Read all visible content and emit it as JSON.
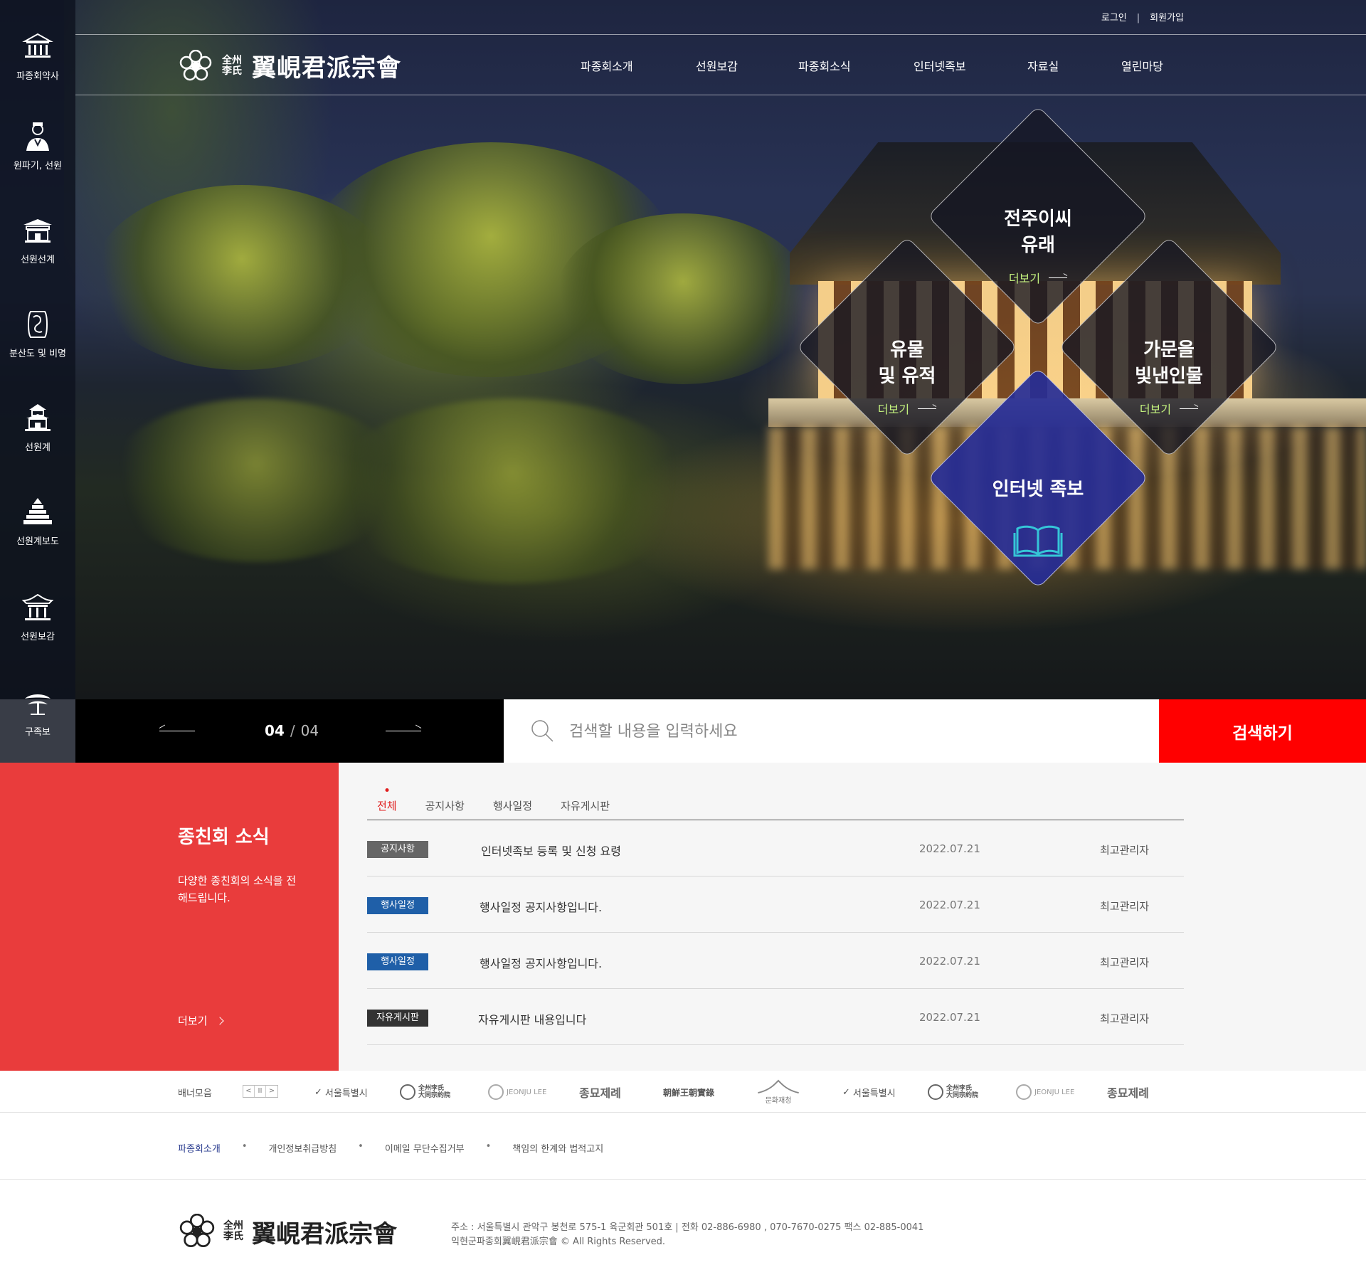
{
  "colors": {
    "accent_red": "#e93c3c",
    "search_red": "#ff0000",
    "diamond_blue": "#262d96",
    "more_green": "#c3f17e"
  },
  "top_links": {
    "login": "로그인",
    "separator": "|",
    "signup": "회원가입"
  },
  "logo": {
    "small_line1": "全州",
    "small_line2": "李氏",
    "big": "翼峴君派宗會"
  },
  "gnb": [
    "파종회소개",
    "선원보감",
    "파종회소식",
    "인터넷족보",
    "자료실",
    "열린마당"
  ],
  "sidebar": [
    {
      "label": "파종회약사",
      "icon": "hall-icon"
    },
    {
      "label": "원파기, 선원",
      "icon": "person-icon"
    },
    {
      "label": "선원선계",
      "icon": "gate-icon"
    },
    {
      "label": "분산도 및 비명",
      "icon": "stone-icon"
    },
    {
      "label": "선원계",
      "icon": "pagoda-icon"
    },
    {
      "label": "선원계보도",
      "icon": "chart-tower-icon"
    },
    {
      "label": "선원보감",
      "icon": "pavilion-icon"
    },
    {
      "label": "구족보",
      "icon": "pine-tree-icon"
    }
  ],
  "diamonds": [
    {
      "title": "전주이씨\n유래",
      "more": "더보기"
    },
    {
      "title": "유물\n및 유적",
      "more": "더보기"
    },
    {
      "title": "가문을\n빛낸인물",
      "more": "더보기"
    },
    {
      "title": "인터넷 족보",
      "icon": "book-icon"
    }
  ],
  "slider": {
    "current": "04",
    "separator": "/",
    "total": "04"
  },
  "search": {
    "placeholder": "검색할 내용을 입력하세요",
    "button": "검색하기"
  },
  "news": {
    "title": "종친회 소식",
    "desc": "다양한 종친회의 소식을 전해드립니다.",
    "more": "더보기",
    "tabs": [
      "전체",
      "공지사항",
      "행사일정",
      "자유게시판"
    ],
    "rows": [
      {
        "badge": "공지사항",
        "badge_color": "#666666",
        "title": "인터넷족보 등록 및 신청 요령",
        "date": "2022.07.21",
        "author": "최고관리자"
      },
      {
        "badge": "행사일정",
        "badge_color": "#1f5fa8",
        "title": "행사일정 공지사항입니다.",
        "date": "2022.07.21",
        "author": "최고관리자"
      },
      {
        "badge": "행사일정",
        "badge_color": "#1f5fa8",
        "title": "행사일정 공지사항입니다.",
        "date": "2022.07.21",
        "author": "최고관리자"
      },
      {
        "badge": "자유게시판",
        "badge_color": "#333333",
        "title": "자유게시판 내용입니다",
        "date": "2022.07.21",
        "author": "최고관리자"
      }
    ]
  },
  "banners": {
    "label": "배너모음",
    "controls": [
      "<",
      "II",
      ">"
    ],
    "items": [
      "서울특별시",
      "全州李氏 大同宗約院",
      "JEONJU LEE",
      "종묘제례",
      "朝鮮王朝實錄",
      "문화재청",
      "서울특별시",
      "全州李氏 大同宗約院",
      "JEONJU LEE",
      "종묘제례"
    ]
  },
  "footer": {
    "links": [
      "파종회소개",
      "개인정보취급방침",
      "이메일 무단수집거부",
      "책임의 한계와 법적고지"
    ],
    "address": "주소 : 서울특별시 관악구 봉천로 575-1 육군회관 501호 | 전화 02-886-6980 , 070-7670-0275 팩스 02-885-0041",
    "copyright": "익현군파종회翼峴君派宗會 © All Rights Reserved."
  }
}
